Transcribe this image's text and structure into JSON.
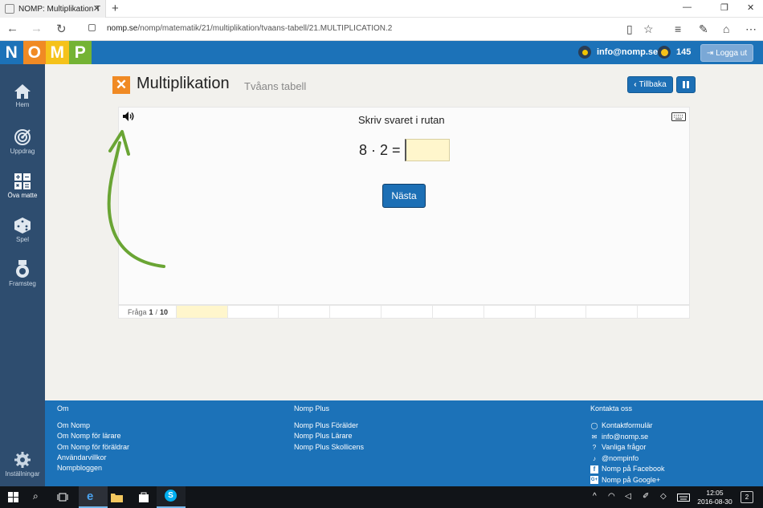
{
  "browser": {
    "tab_title": "NOMP: Multiplikation T",
    "url_host": "nomp.se",
    "url_path": "/nomp/matematik/21/multiplikation/tvaans-tabell/21.MULTIPLICATION.2"
  },
  "header": {
    "logo_letters": [
      "N",
      "O",
      "M",
      "P"
    ],
    "logo_colors": [
      "#1c72b8",
      "#f08a24",
      "#f5c21a",
      "#74b334"
    ],
    "user_email": "info@nomp.se",
    "coins": "145",
    "logout_label": "Logga ut"
  },
  "sidebar": {
    "items": [
      {
        "label": "Hem",
        "icon": "home-icon"
      },
      {
        "label": "Uppdrag",
        "icon": "target-icon"
      },
      {
        "label": "Öva matte",
        "icon": "calculator-icon"
      },
      {
        "label": "Spel",
        "icon": "dice-icon"
      },
      {
        "label": "Framsteg",
        "icon": "medal-icon"
      }
    ],
    "settings_label": "Inställningar"
  },
  "page": {
    "title": "Multiplikation",
    "subtitle": "Tvåans tabell",
    "back_label": "Tillbaka"
  },
  "question": {
    "instruction": "Skriv svaret i rutan",
    "expression": "8 · 2 =",
    "answer_value": "",
    "next_label": "Nästa",
    "progress_label": "Fråga",
    "current": "1",
    "total": "10"
  },
  "footer": {
    "col1": {
      "heading": "Om",
      "links": [
        "Om Nomp",
        "Om Nomp för lärare",
        "Om Nomp för föräldrar",
        "Användarvillkor",
        "Nompbloggen"
      ]
    },
    "col2": {
      "heading": "Nomp Plus",
      "links": [
        "Nomp Plus Förälder",
        "Nomp Plus Lärare",
        "Nomp Plus Skollicens"
      ]
    },
    "col3": {
      "heading": "Kontakta oss",
      "links": [
        "Kontaktformulär",
        "info@nomp.se",
        "Vanliga frågor",
        "@nompinfo",
        "Nomp på Facebook",
        "Nomp på Google+"
      ]
    }
  },
  "taskbar": {
    "time": "12:05",
    "date": "2016-08-30",
    "notifications": "2"
  },
  "colors": {
    "accent": "#1c72b8",
    "sidebar": "#2e4d6f",
    "answer_box": "#fff6cc",
    "arrow": "#6aa534"
  }
}
